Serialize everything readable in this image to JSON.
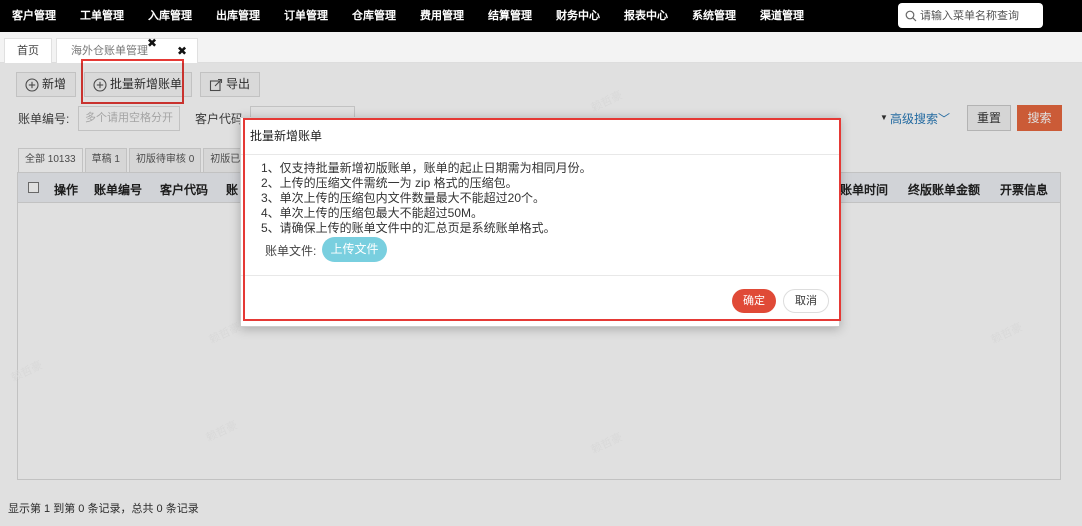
{
  "topnav": {
    "menu": [
      "客户管理",
      "工单管理",
      "入库管理",
      "出库管理",
      "订单管理",
      "仓库管理",
      "费用管理",
      "结算管理",
      "财务中心",
      "报表中心",
      "系统管理",
      "渠道管理"
    ],
    "search_placeholder": "请输入菜单名称查询"
  },
  "tabs": {
    "home": "首页",
    "active": "海外仓账单管理",
    "close": "✖"
  },
  "toolbar": {
    "add": "新增",
    "batch_add": "批量新增账单",
    "export": "导出"
  },
  "filters": {
    "bill_no_label": "账单编号:",
    "bill_no_placeholder": "多个请用空格分开",
    "customer_code_label": "客户代码",
    "advanced": "高级搜索",
    "reset": "重置",
    "search": "搜索"
  },
  "status_tabs": [
    "全部 10133",
    "草稿 1",
    "初版待审核 0",
    "初版已审"
  ],
  "grid": {
    "headers_left": [
      "操作",
      "账单编号",
      "客户代码",
      "账"
    ],
    "headers_right": [
      "账单时间",
      "终版账单金额",
      "开票信息"
    ]
  },
  "footer": {
    "info": "显示第 1 到第 0 条记录，总共 0 条记录"
  },
  "dialog": {
    "title": "批量新增账单",
    "rules": [
      "1、仅支持批量新增初版账单，账单的起止日期需为相同月份。",
      "2、上传的压缩文件需统一为 zip 格式的压缩包。",
      "3、单次上传的压缩包内文件数量最大不能超过20个。",
      "4、单次上传的压缩包最大不能超过50M。",
      "5、请确保上传的账单文件中的汇总页是系统账单格式。"
    ],
    "file_label": "账单文件:",
    "upload": "上传文件",
    "ok": "确定",
    "cancel": "取消"
  },
  "watermark": "赖哲豪",
  "colors": {
    "nav_bg": "#000000",
    "highlight": "#e53935",
    "search_btn": "#e8683f",
    "ok_btn": "#e04a37",
    "upload_btn": "#79cfdf"
  }
}
